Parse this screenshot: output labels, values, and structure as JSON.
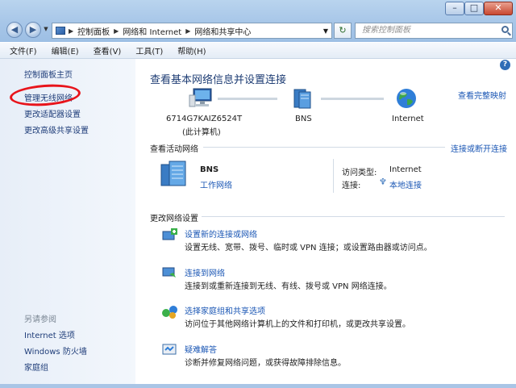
{
  "window": {
    "minimize": "–",
    "maximize": "□",
    "close": "✕"
  },
  "nav": {
    "back": "◀",
    "forward": "▶"
  },
  "address": {
    "segments": [
      "控制面板",
      "网络和 Internet",
      "网络和共享中心"
    ]
  },
  "search": {
    "placeholder": "搜索控制面板"
  },
  "menu": [
    "文件(F)",
    "编辑(E)",
    "查看(V)",
    "工具(T)",
    "帮助(H)"
  ],
  "sidebar": {
    "items": [
      "控制面板主页",
      "管理无线网络",
      "更改适配器设置",
      "更改高级共享设置"
    ],
    "see_also_header": "另请参阅",
    "see_also": [
      "Internet 选项",
      "Windows 防火墙",
      "家庭组"
    ]
  },
  "main": {
    "title": "查看基本网络信息并设置连接",
    "full_map": "查看完整映射",
    "map": {
      "computer_name": "6714G7KAIZ6524T",
      "computer_sub": "(此计算机)",
      "network": "BNS",
      "internet": "Internet"
    },
    "active_header": "查看活动网络",
    "connect_disconnect": "连接或断开连接",
    "active": {
      "name": "BNS",
      "type": "工作网络",
      "access_label": "访问类型:",
      "access_value": "Internet",
      "conn_label": "连接:",
      "conn_value": "本地连接"
    },
    "change_header": "更改网络设置",
    "tasks": [
      {
        "title": "设置新的连接或网络",
        "desc": "设置无线、宽带、拨号、临时或 VPN 连接；或设置路由器或访问点。"
      },
      {
        "title": "连接到网络",
        "desc": "连接到或重新连接到无线、有线、拨号或 VPN 网络连接。"
      },
      {
        "title": "选择家庭组和共享选项",
        "desc": "访问位于其他网络计算机上的文件和打印机，或更改共享设置。"
      },
      {
        "title": "疑难解答",
        "desc": "诊断并修复网络问题，或获得故障排除信息。"
      }
    ]
  },
  "colors": {
    "link": "#1a56b4",
    "heading": "#1e3d74",
    "annotation": "#e8141b"
  }
}
